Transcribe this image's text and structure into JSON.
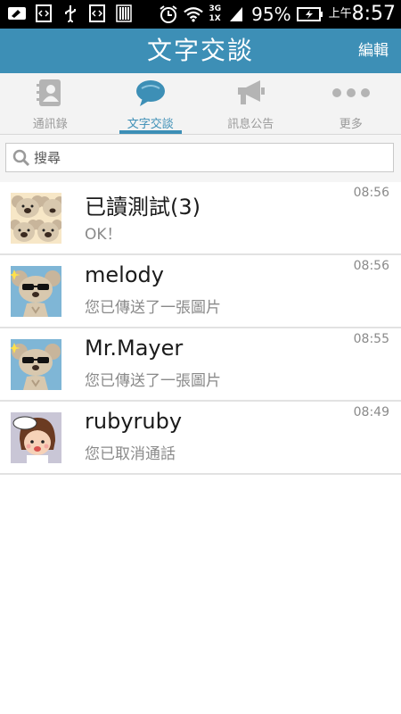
{
  "status_bar": {
    "battery": "95%",
    "clock_period": "上午",
    "clock_time": "8:57",
    "network_top": "3G",
    "network_bottom": "1X"
  },
  "header": {
    "title": "文字交談",
    "edit_label": "編輯"
  },
  "tabs": [
    {
      "label": "通訊錄",
      "icon": "contacts-book-icon",
      "active": false
    },
    {
      "label": "文字交談",
      "icon": "chat-bubble-icon",
      "active": true
    },
    {
      "label": "訊息公告",
      "icon": "megaphone-icon",
      "active": false
    },
    {
      "label": "更多",
      "icon": "more-dots-icon",
      "active": false
    }
  ],
  "search": {
    "placeholder": "搜尋"
  },
  "chats": [
    {
      "name": "已讀測試(3)",
      "preview": "OK！",
      "time": "08:56",
      "avatar": "group-koala-avatar"
    },
    {
      "name": "melody",
      "preview": "您已傳送了一張圖片",
      "time": "08:56",
      "avatar": "koala-sunglasses-avatar"
    },
    {
      "name": "Mr.Mayer",
      "preview": "您已傳送了一張圖片",
      "time": "08:55",
      "avatar": "koala-sunglasses-avatar"
    },
    {
      "name": "rubyruby",
      "preview": "您已取消通話",
      "time": "08:49",
      "avatar": "girl-sticker-avatar"
    }
  ],
  "colors": {
    "accent": "#3d8fb6",
    "tab_inactive": "#9a9a9a",
    "divider": "#e2e2e2"
  }
}
